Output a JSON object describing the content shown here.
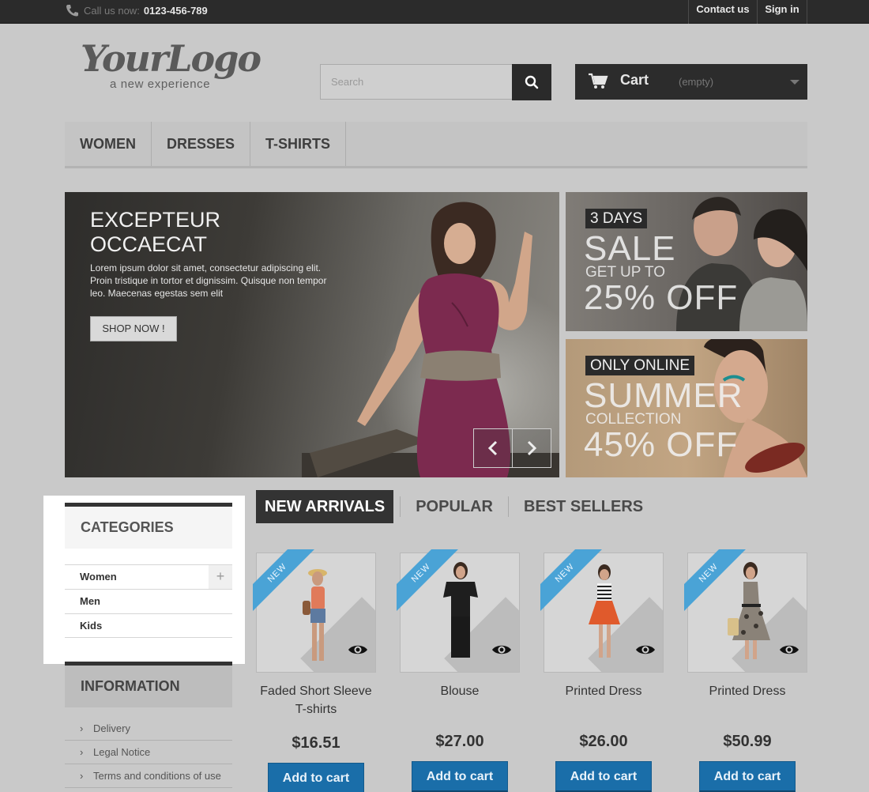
{
  "topbar": {
    "call_label": "Call us now:",
    "phone": "0123-456-789",
    "contact": "Contact us",
    "signin": "Sign in"
  },
  "logo": {
    "script": "YourLogo",
    "tagline": "a new experience"
  },
  "search": {
    "placeholder": "Search",
    "icon": "search-icon"
  },
  "cart": {
    "label": "Cart",
    "status": "(empty)",
    "icon": "cart-icon"
  },
  "menu": {
    "items": [
      "WOMEN",
      "DRESSES",
      "T-SHIRTS"
    ]
  },
  "hero": {
    "title": "EXCEPTEUR OCCAECAT",
    "description": "Lorem ipsum dolor sit amet, consectetur adipiscing elit. Proin tristique in tortor et dignissim. Quisque non tempor leo. Maecenas egestas sem elit",
    "button": "SHOP NOW !"
  },
  "banners": [
    {
      "pill": "3 DAYS",
      "big": "SALE",
      "small": "GET UP TO",
      "big2": "25% OFF"
    },
    {
      "pill": "ONLY ONLINE",
      "big": "SUMMER",
      "small": "COLLECTION",
      "big2": "45% OFF"
    }
  ],
  "categories": {
    "title": "CATEGORIES",
    "items": [
      "Women",
      "Men",
      "Kids"
    ]
  },
  "information": {
    "title": "INFORMATION",
    "items": [
      "Delivery",
      "Legal Notice",
      "Terms and conditions of use"
    ]
  },
  "tabs": [
    "NEW ARRIVALS",
    "POPULAR",
    "BEST SELLERS"
  ],
  "products": [
    {
      "badge": "NEW",
      "name": "Faded Short Sleeve T-shirts",
      "price": "$16.51",
      "button": "Add to cart"
    },
    {
      "badge": "NEW",
      "name": "Blouse",
      "price": "$27.00",
      "button": "Add to cart"
    },
    {
      "badge": "NEW",
      "name": "Printed Dress",
      "price": "$26.00",
      "button": "Add to cart"
    },
    {
      "badge": "NEW",
      "name": "Printed Dress",
      "price": "$50.99",
      "button": "Add to cart"
    }
  ],
  "colors": {
    "accent": "#1a6ea9",
    "ribbon": "#4aa3d6",
    "dark": "#2c2c2c"
  }
}
